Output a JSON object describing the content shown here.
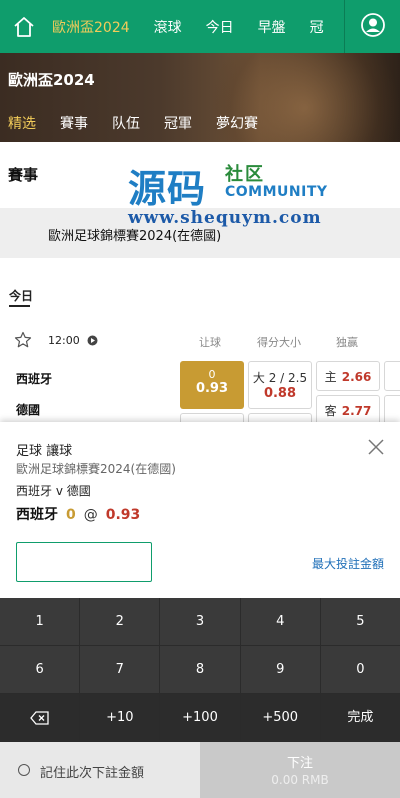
{
  "nav": {
    "items": [
      {
        "label": "歐洲盃2024",
        "active": true
      },
      {
        "label": "滾球",
        "active": false
      },
      {
        "label": "今日",
        "active": false
      },
      {
        "label": "早盤",
        "active": false
      },
      {
        "label": "冠",
        "active": false
      }
    ],
    "accent_color": "#0f9d6c",
    "active_color": "#f2cc5a"
  },
  "banner": {
    "title": "歐洲盃2024",
    "tabs": [
      "精选",
      "賽事",
      "队伍",
      "冠軍",
      "夢幻賽"
    ],
    "active_tab": 0
  },
  "section": {
    "title": "賽事"
  },
  "watermark": {
    "big": "源码",
    "small": "社区",
    "community": "COMMUNITY",
    "url": "www.shequym.com"
  },
  "league": {
    "name": "歐洲足球錦標賽2024(在德國)"
  },
  "date_tab": "今日",
  "match": {
    "time": "12:00",
    "columns": [
      "让球",
      "得分大小",
      "独赢"
    ],
    "home": "西班牙",
    "away": "德國",
    "handicap": {
      "line": "0",
      "odds": "0.93"
    },
    "total": {
      "line": "大 2 / 2.5",
      "odds": "0.88"
    },
    "moneyline": [
      {
        "label": "主",
        "odds": "2.66"
      },
      {
        "label": "客",
        "odds": "2.77"
      }
    ]
  },
  "betslip": {
    "type": "足球 讓球",
    "league": "歐洲足球錦標賽2024(在德國)",
    "match": "西班牙 v 德國",
    "pick_team": "西班牙",
    "pick_line": "0",
    "at": "@",
    "pick_odds": "0.93",
    "stake_value": "",
    "stake_placeholder": "",
    "max_label": "最大投註金額",
    "keypad_row1": [
      "1",
      "2",
      "3",
      "4",
      "5"
    ],
    "keypad_row2": [
      "6",
      "7",
      "8",
      "9",
      "0"
    ],
    "keypad_row3": [
      "+10",
      "+100",
      "+500",
      "完成"
    ],
    "remember_label": "記住此次下註金額",
    "place_bet_label": "下注",
    "place_bet_amount": "0.00 RMB"
  }
}
